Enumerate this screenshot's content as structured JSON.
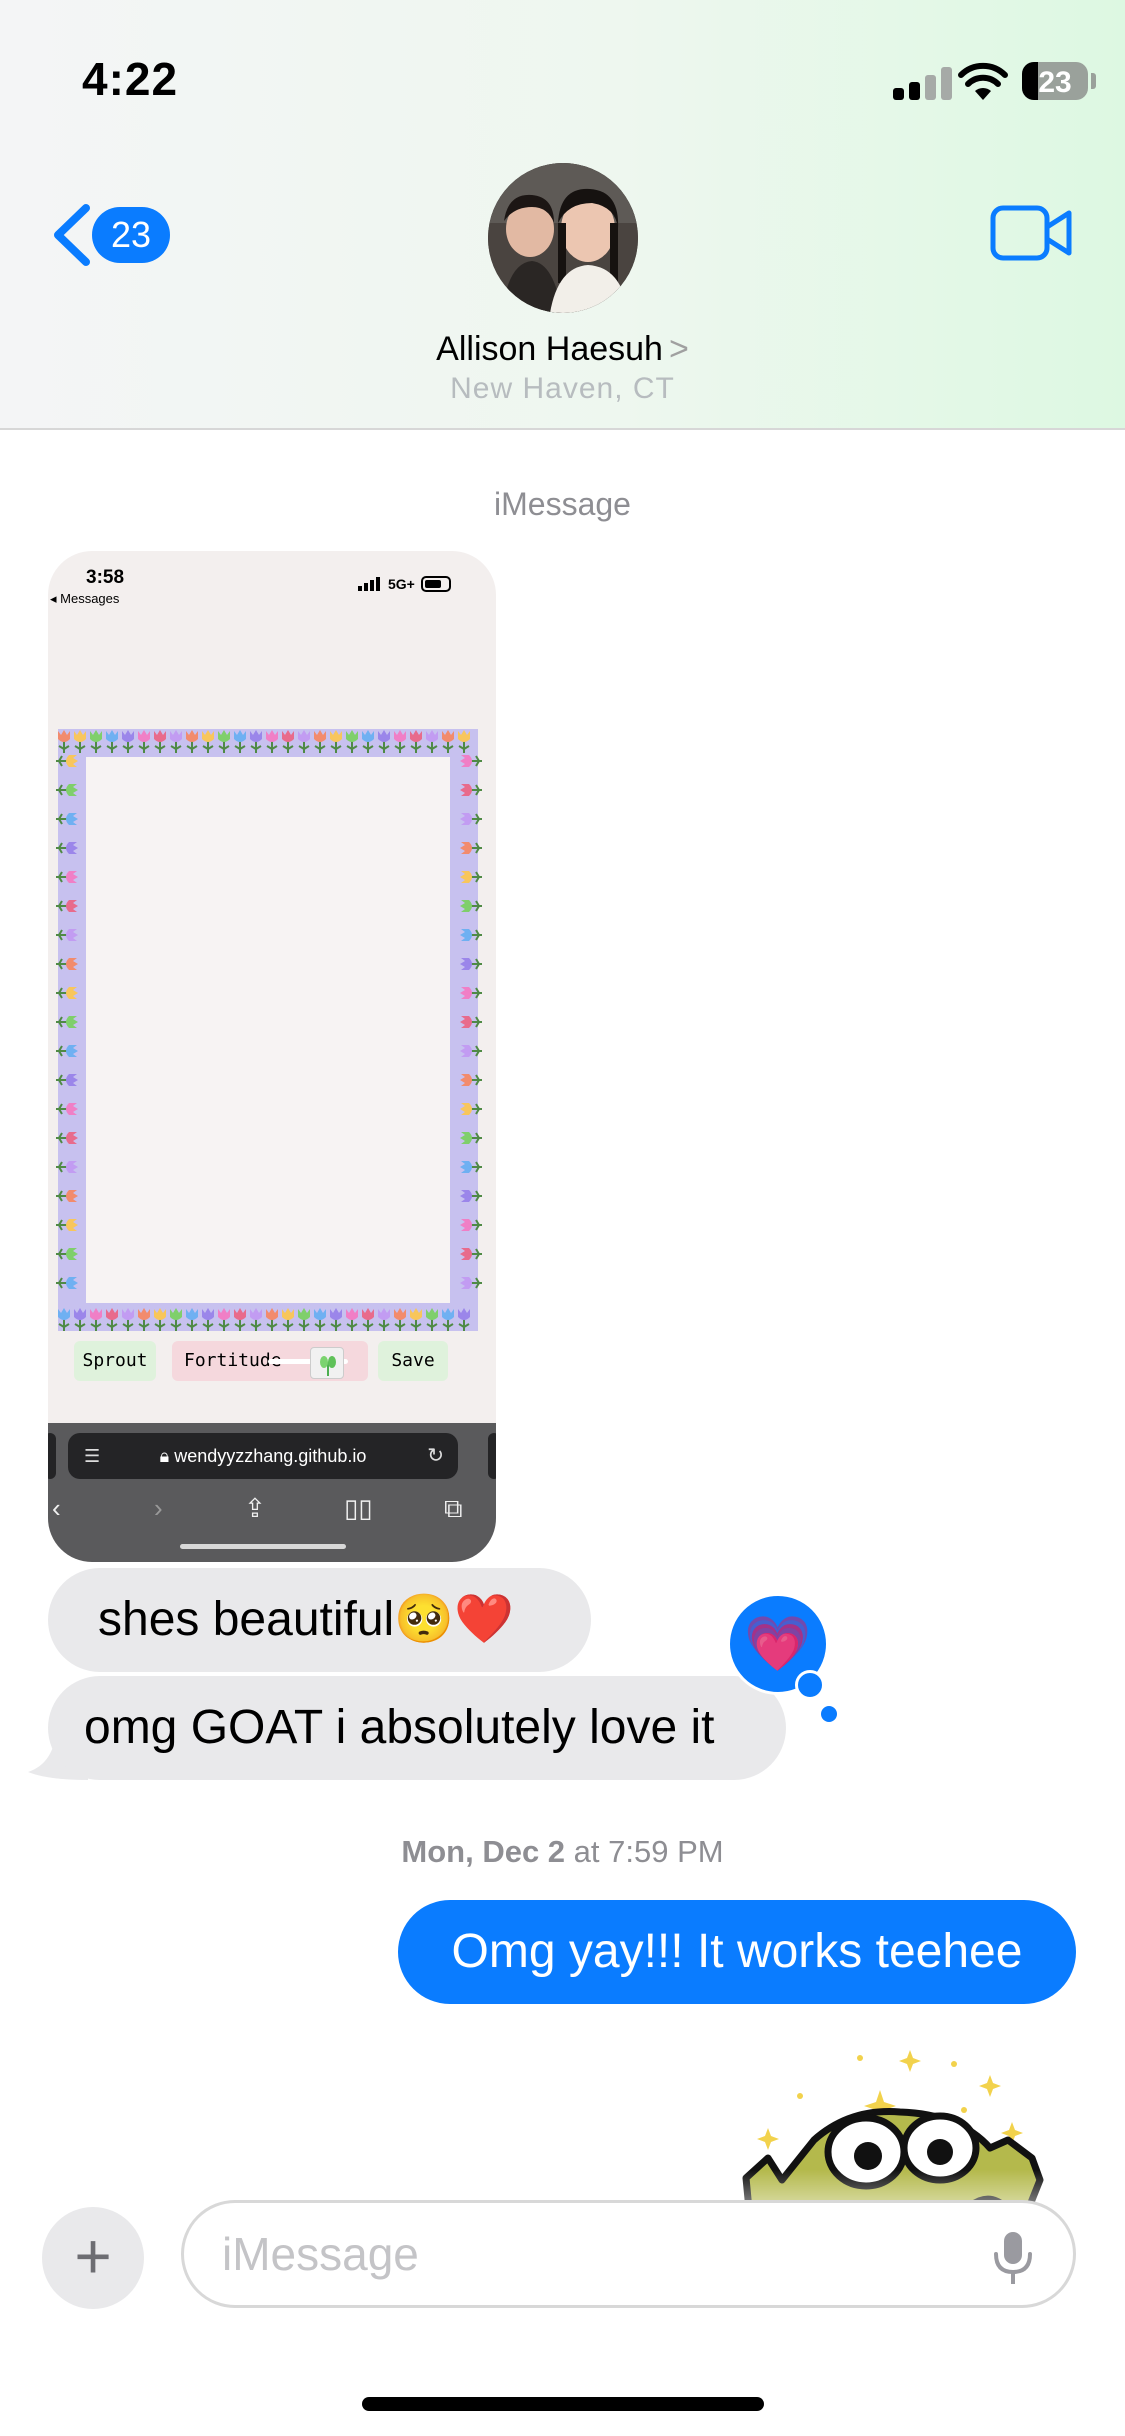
{
  "status_bar": {
    "time": "4:22",
    "battery": "23"
  },
  "header": {
    "back_count": "23",
    "contact_name": "Allison Haesuh",
    "name_chevron": ">",
    "location": "New Haven, CT"
  },
  "conversation": {
    "service_label": "iMessage",
    "screenshot": {
      "time": "3:58",
      "back_label": "◂ Messages",
      "network": "5G+",
      "sprout_button": "Sprout",
      "fortitude_button": "Fortitude",
      "save_button": "Save",
      "url": "wendyyzzhang.github.io"
    },
    "messages": [
      {
        "text": "shes beautiful🥺❤️",
        "sender": "contact"
      },
      {
        "text": "omg GOAT i absolutely love it",
        "sender": "contact"
      },
      {
        "text": "Omg yay!!! It works teehee",
        "sender": "me"
      }
    ],
    "tapback": "💗",
    "timestamp_day": "Mon, Dec 2",
    "timestamp_time": " at 7:59 PM"
  },
  "input": {
    "placeholder": "iMessage"
  },
  "colors": {
    "imessage_blue": "#0a7cff",
    "received_gray": "#e9e9eb",
    "meta_gray": "#8e8e93"
  },
  "icons": [
    "back-chevron-icon",
    "video-call-icon",
    "plus-icon",
    "microphone-icon",
    "cellular-signal-icon",
    "wifi-icon",
    "battery-icon",
    "heart-tapback-icon",
    "frog-sticker"
  ]
}
